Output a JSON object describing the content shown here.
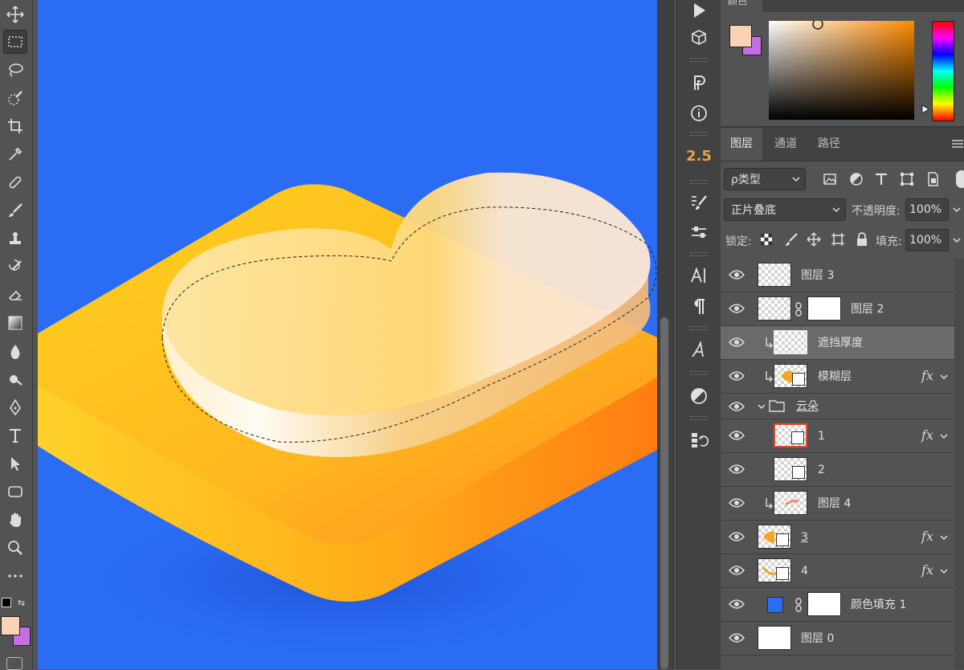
{
  "color_panel": {
    "title": "颜色",
    "foreground": "#fbd3b4",
    "background": "#c66ee6",
    "picked_hue": "#ff8a00"
  },
  "side_strip": {
    "zoom_value": "2.5"
  },
  "layers_panel": {
    "tabs": [
      {
        "label": "图层"
      },
      {
        "label": "通道"
      },
      {
        "label": "路径"
      }
    ],
    "filter_kind": "ρ类型",
    "blend_mode": "正片叠底",
    "opacity_label": "不透明度:",
    "opacity_value": "100%",
    "lock_label": "锁定:",
    "fill_label": "填充:",
    "fill_value": "100%",
    "group_name": "云朵",
    "layers": [
      {
        "name": "图层 3"
      },
      {
        "name": "图层 2"
      },
      {
        "name": "遮挡厚度"
      },
      {
        "name": "模糊层"
      },
      {
        "name": "云朵"
      },
      {
        "name": "1"
      },
      {
        "name": "2"
      },
      {
        "name": "图层 4"
      },
      {
        "name": "3"
      },
      {
        "name": "4"
      },
      {
        "name": "颜色填充 1"
      },
      {
        "name": "图层 0"
      }
    ]
  },
  "colors": {
    "canvas_bg": "#2b6cf5",
    "selection_highlight": "#e14a2a",
    "accent": "#f0a03c"
  }
}
